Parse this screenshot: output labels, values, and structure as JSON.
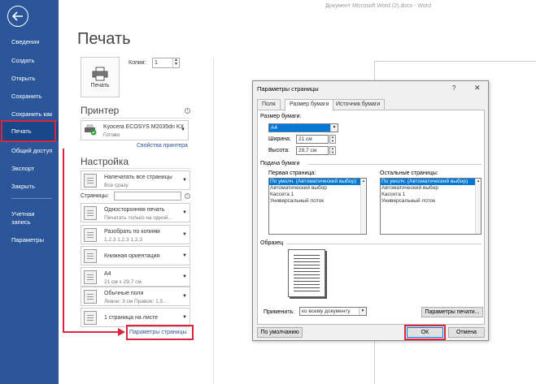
{
  "window": {
    "title": "Документ Microsoft Word (2).docx - Word"
  },
  "sidebar": {
    "items": [
      {
        "label": "Сведения"
      },
      {
        "label": "Создать"
      },
      {
        "label": "Открыть"
      },
      {
        "label": "Сохранить"
      },
      {
        "label": "Сохранить как"
      },
      {
        "label": "Печать"
      },
      {
        "label": "Общий доступ"
      },
      {
        "label": "Экспорт"
      },
      {
        "label": "Закрыть"
      },
      {
        "label_line1": "Учетная",
        "label_line2": "запись"
      },
      {
        "label": "Параметры"
      }
    ]
  },
  "print": {
    "title": "Печать",
    "button_label": "Печать",
    "copies_label": "Копии:",
    "copies_value": "1",
    "printer_heading": "Принтер",
    "printer_name": "Kyocera ECOSYS M2035dn KX",
    "printer_status": "Готово",
    "printer_props": "Свойства принтера",
    "settings_heading": "Настройка",
    "settings": [
      {
        "line1": "Напечатать все страницы",
        "line2": "Все сразу"
      },
      {
        "line1": "Односторонняя печать",
        "line2": "Печатать только на одной..."
      },
      {
        "line1": "Разобрать по копиям",
        "line2": "1,2,3    1,2,3    1,2,3"
      },
      {
        "line1": "Книжная ориентация",
        "line2": ""
      },
      {
        "line1": "А4",
        "line2": "21 см x 29,7 см"
      },
      {
        "line1": "Обычные поля",
        "line2": "Левое: 3 см    Правое: 1,5..."
      },
      {
        "line1": "1 страница на листе",
        "line2": ""
      }
    ],
    "pages_label": "Страницы:",
    "page_setup_link": "Параметры страницы"
  },
  "dialog": {
    "title": "Параметры страницы",
    "help": "?",
    "close": "✕",
    "tabs": [
      "Поля",
      "Размер бумаги",
      "Источник бумаги"
    ],
    "paper_size_label": "Размер бумаги:",
    "paper_size_value": "А4",
    "width_label": "Ширина:",
    "width_value": "21 см",
    "height_label": "Высота:",
    "height_value": "29,7 см",
    "paper_source_label": "Подача бумаги",
    "first_page_label": "Первая страница:",
    "other_pages_label": "Остальные страницы:",
    "trays": [
      "По умолч. (Автоматический выбор)",
      "Автоматический выбор",
      "Кассета 1",
      "Универсальный лоток"
    ],
    "sample_label": "Образец",
    "apply_label": "Применить:",
    "apply_value": "ко всему документу",
    "print_options": "Параметры печати...",
    "default_button": "По умолчанию",
    "ok_button": "ОК",
    "cancel_button": "Отмена"
  }
}
